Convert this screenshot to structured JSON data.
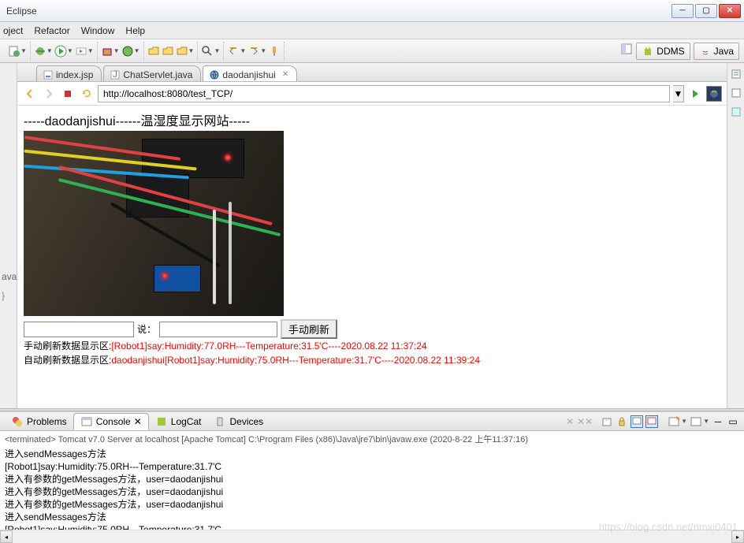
{
  "window": {
    "title": "Eclipse"
  },
  "menu": {
    "items": [
      "oject",
      "Refactor",
      "Window",
      "Help"
    ]
  },
  "perspectives": {
    "ddms": "DDMS",
    "java": "Java"
  },
  "editor_tabs": [
    {
      "label": "index.jsp",
      "active": false
    },
    {
      "label": "ChatServlet.java",
      "active": false
    },
    {
      "label": "daodanjishui",
      "active": true
    }
  ],
  "browser": {
    "url": "http://localhost:8080/test_TCP/"
  },
  "page": {
    "heading": "-----daodanjishui------温湿度显示网站-----",
    "say_label": "说：",
    "refresh_btn": "手动刷新",
    "manual_label": "手动刷新数据显示区:",
    "manual_data": "[Robot1]say:Humidity:77.0RH---Temperature:31.5'C----2020.08.22 11:37:24",
    "auto_label": "自动刷新数据显示区:",
    "auto_data": "daodanjishui[Robot1]say:Humidity:75.0RH---Temperature:31.7'C----2020.08.22 11:39:24"
  },
  "bottom_tabs": {
    "problems": "Problems",
    "console": "Console",
    "logcat": "LogCat",
    "devices": "Devices"
  },
  "console": {
    "terminated": "<terminated> Tomcat v7.0 Server at localhost [Apache Tomcat] C:\\Program Files (x86)\\Java\\jre7\\bin\\javaw.exe (2020-8-22 上午11:37:16)",
    "lines": [
      "进入sendMessages方法",
      "[Robot1]say:Humidity:75.0RH---Temperature:31.7'C",
      "进入有参数的getMessages方法，user=daodanjishui",
      "进入有参数的getMessages方法，user=daodanjishui",
      "进入有参数的getMessages方法，user=daodanjishui",
      "进入sendMessages方法",
      "[Robot1]say:Humidity:75.0RH---Temperature:31.7'C"
    ]
  },
  "left_stub": {
    "java": "ava",
    "bracket": "}"
  },
  "watermark": "https://blog.csdn.net/nmxi0401"
}
